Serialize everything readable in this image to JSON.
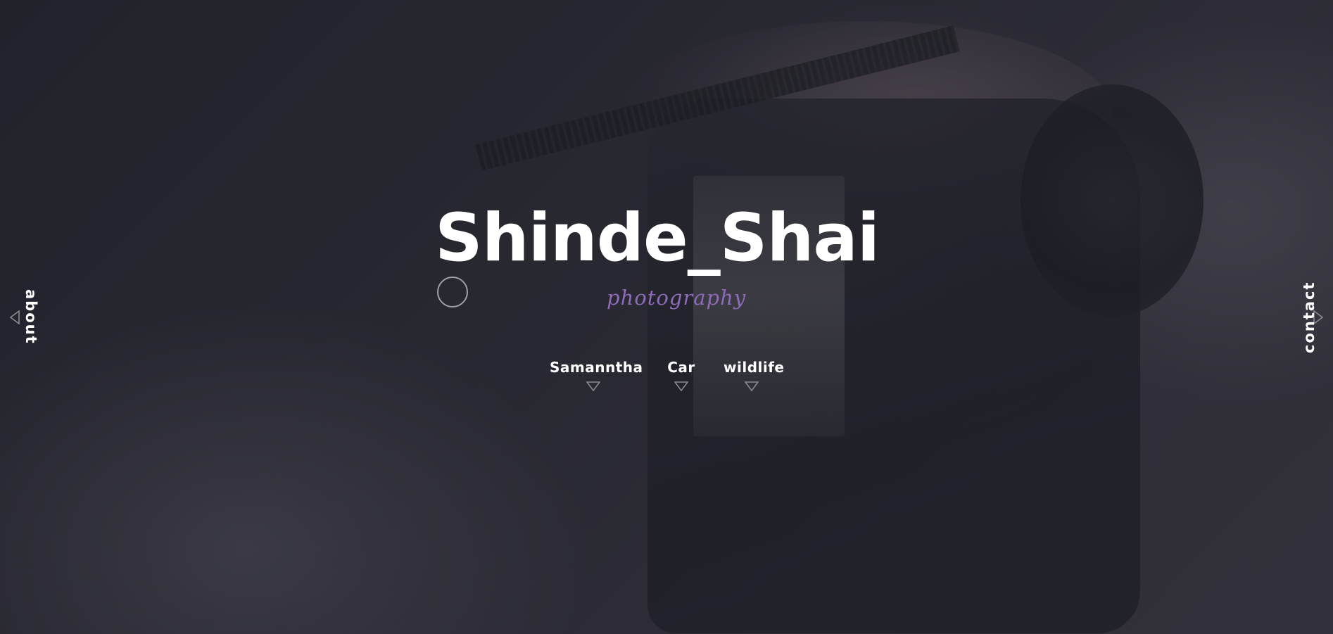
{
  "brand": {
    "title": "Shinde_Shai",
    "subtitle": "photography"
  },
  "nav": {
    "items": [
      {
        "label": "Samanntha"
      },
      {
        "label": "Car"
      },
      {
        "label": "wildlife"
      }
    ]
  },
  "side": {
    "left_label": "about",
    "right_label": "contact"
  },
  "colors": {
    "accent": "#8e6ab8",
    "text": "#ffffff",
    "outline": "#8a8a92"
  },
  "icons": {
    "nav_indicator": "triangle-down-outline-icon",
    "left_arrow": "triangle-left-outline-icon",
    "right_arrow": "triangle-right-outline-icon",
    "brand_ring": "circle-outline-icon"
  }
}
